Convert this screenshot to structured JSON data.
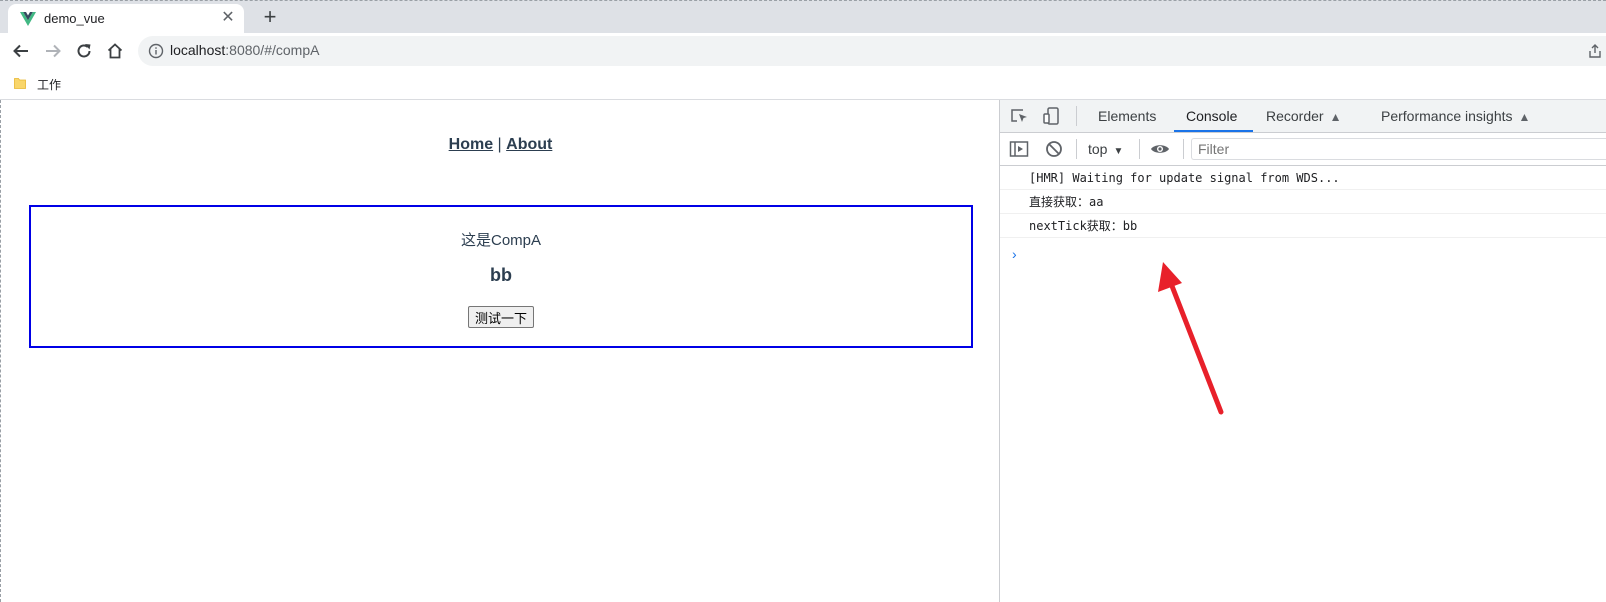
{
  "browser": {
    "tab": {
      "title": "demo_vue",
      "close": "✕"
    },
    "new_tab": "+",
    "url": {
      "host": "localhost",
      "rest": ":8080/#/compA"
    },
    "bookmark": {
      "label": "工作"
    }
  },
  "page": {
    "nav": {
      "home": "Home",
      "separator": " | ",
      "about": "About"
    },
    "component": {
      "title": "这是CompA",
      "value": "bb",
      "button": "测试一下"
    },
    "colors": {
      "box_border": "#0000e6",
      "text": "#2c3e50"
    }
  },
  "devtools": {
    "tabs": [
      {
        "label": "Elements",
        "active": false
      },
      {
        "label": "Console",
        "active": true
      },
      {
        "label": "Recorder",
        "active": false,
        "experimental": true
      },
      {
        "label": "Performance insights",
        "active": false,
        "experimental": true
      }
    ],
    "context": "top",
    "filter_placeholder": "Filter",
    "logs": [
      "[HMR] Waiting for update signal from WDS...",
      "直接获取：aa",
      "nextTick获取：bb"
    ],
    "prompt": "›"
  },
  "annotation": {
    "arrow_color": "#e8202a"
  }
}
